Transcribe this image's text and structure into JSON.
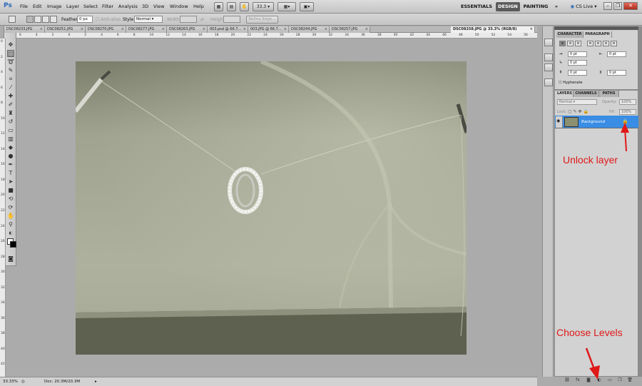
{
  "app": {
    "logo": "Ps"
  },
  "menu": [
    "File",
    "Edit",
    "Image",
    "Layer",
    "Select",
    "Filter",
    "Analysis",
    "3D",
    "View",
    "Window",
    "Help"
  ],
  "appbar": {
    "zoom": "33.3",
    "workspaces": [
      "ESSENTIALS",
      "DESIGN",
      "PAINTING"
    ],
    "more": "»",
    "cs_live": "CS Live"
  },
  "window_controls": {
    "minimize": "–",
    "restore": "❐",
    "close": "✕"
  },
  "options": {
    "feather_label": "Feather:",
    "feather_value": "0 px",
    "antialias_label": "Anti-alias",
    "style_label": "Style:",
    "style_value": "Normal",
    "width_label": "Width:",
    "height_label": "Height:",
    "refine_edge": "Refine Edge..."
  },
  "tabs": [
    {
      "label": "DSC08233.JPG"
    },
    {
      "label": "DSC08251.JPG"
    },
    {
      "label": "DSC08270.JPG"
    },
    {
      "label": "DSC08277.JPG"
    },
    {
      "label": "DSC08263.JPG"
    },
    {
      "label": "003.psd @ 66.7..."
    },
    {
      "label": "003.JPG @ 66.7..."
    },
    {
      "label": "DSC08244.JPG"
    },
    {
      "label": "DSC08257.JPG"
    },
    {
      "label": "DSC08258.JPG @ 33.3% (RGB/8)"
    }
  ],
  "rulers": {
    "top": [
      "6",
      "4",
      "2",
      "0",
      "2",
      "4",
      "6",
      "8",
      "10",
      "12",
      "14",
      "16",
      "18",
      "20",
      "22",
      "24",
      "26",
      "28",
      "30",
      "32",
      "34",
      "36",
      "38",
      "40",
      "42",
      "44",
      "46",
      "48",
      "50",
      "52",
      "54",
      "56"
    ],
    "left": [
      "0",
      "2",
      "4",
      "6",
      "8",
      "10",
      "12",
      "14",
      "16",
      "18",
      "20",
      "22",
      "24",
      "26",
      "28",
      "30",
      "32",
      "34",
      "36",
      "38",
      "40",
      "42"
    ]
  },
  "status": {
    "zoom": "33.33%",
    "doc": "Doc: 20.3M/20.3M"
  },
  "char_panel": {
    "tabs": [
      "CHARACTER",
      "PARAGRAPH"
    ],
    "indent_left": "0 pt",
    "indent_right": "0 pt",
    "indent_first": "0 pt",
    "space_before": "0 pt",
    "space_after": "0 pt",
    "hyphenate": "Hyphenate"
  },
  "layers_panel": {
    "tabs": [
      "LAYERS",
      "CHANNELS",
      "PATHS"
    ],
    "blend_mode": "Normal",
    "opacity_label": "Opacity:",
    "opacity_value": "100%",
    "lock_label": "Lock:",
    "fill_label": "Fill:",
    "fill_value": "100%",
    "layers": [
      {
        "name": "Background",
        "locked": true
      }
    ]
  },
  "annotations": {
    "unlock": "Unlock layer",
    "levels": "Choose Levels"
  },
  "colors": {
    "selection": "#3a8de4",
    "annotation": "#e01818",
    "canvas": "#a8ad9c"
  }
}
